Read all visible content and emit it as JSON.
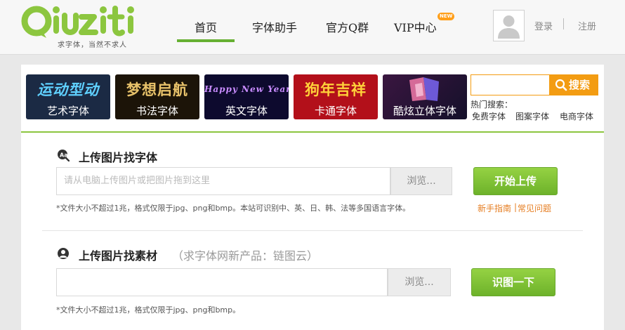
{
  "brand": {
    "logo_text": "Qiuziti",
    "slogan": "求字体，当然不求人",
    "accent": "#8cc63f"
  },
  "nav": {
    "items": [
      {
        "label": "首页",
        "active": true
      },
      {
        "label": "字体助手",
        "active": false
      },
      {
        "label": "官方Q群",
        "active": false
      },
      {
        "label": "VIP中心",
        "active": false
      }
    ],
    "new_badge": "NEW"
  },
  "account": {
    "avatar_icon": "user-avatar-icon",
    "login": "登录",
    "register": "注册"
  },
  "categories": [
    {
      "art": "运动型动",
      "label": "艺术字体",
      "bg": "#1b2a44",
      "color": "#5fd0ff"
    },
    {
      "art": "梦想启航",
      "label": "书法字体",
      "bg": "#1c1408",
      "color": "#e8c26a"
    },
    {
      "art": "Happy New Year",
      "label": "英文字体",
      "bg": "#0d0a2e",
      "color": "#c98cff"
    },
    {
      "art": "狗年吉祥",
      "label": "卡通字体",
      "bg": "#b3101a",
      "color": "#ffd23a"
    },
    {
      "art": "",
      "label": "酷炫立体字体",
      "bg": "#2a1030",
      "color": "#ff7fb0"
    }
  ],
  "search": {
    "placeholder": "",
    "button": "搜索",
    "hot_label": "热门搜索：",
    "hot_links": [
      "免费字体",
      "图案字体",
      "电商字体"
    ],
    "accent": "#f39c12"
  },
  "font_upload": {
    "title": "上传图片找字体",
    "placeholder": "请从电脑上传图片或把图片拖到这里",
    "browse": "浏览...",
    "button": "开始上传",
    "note": "*文件大小不超过1兆，格式仅限于jpg、png和bmp。本站可识别中、英、日、韩、法等多国语言字体。",
    "help": "新手指南",
    "faq": "常见问题"
  },
  "material_upload": {
    "title": "上传图片找素材",
    "subtitle": "（求字体网新产品：链图云）",
    "browse": "浏览...",
    "button": "识图一下",
    "note": "*文件大小不超过1兆，格式仅限于jpg、png和bmp。"
  }
}
